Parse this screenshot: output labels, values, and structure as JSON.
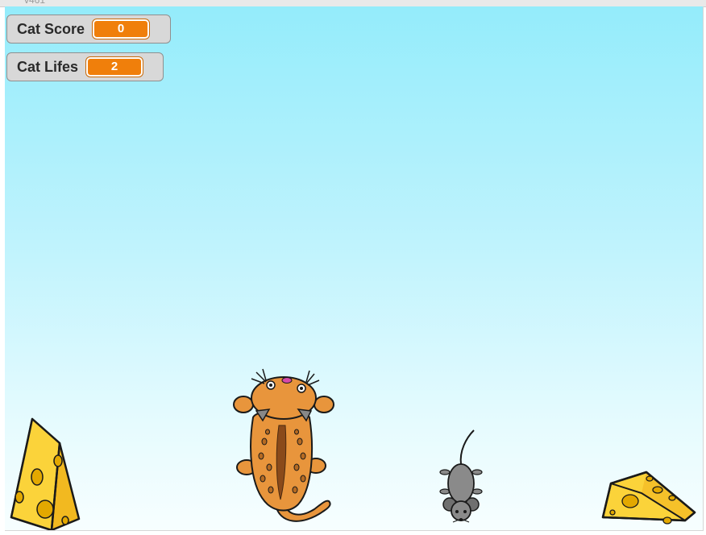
{
  "topbar": {
    "version": "v461"
  },
  "stage": {
    "monitors": [
      {
        "label": "Cat Score",
        "value": "0"
      },
      {
        "label": "Cat Lifes",
        "value": "2"
      }
    ],
    "sprites": [
      "cheese-left",
      "cat",
      "mouse",
      "cheese-right"
    ]
  },
  "colors": {
    "sky_top": "#94ecfb",
    "sky_bottom": "#f7feff",
    "monitor_value": "#f07f0b",
    "cat": "#e8953c",
    "cheese": "#fbd33a",
    "mouse": "#8a8a8a"
  }
}
